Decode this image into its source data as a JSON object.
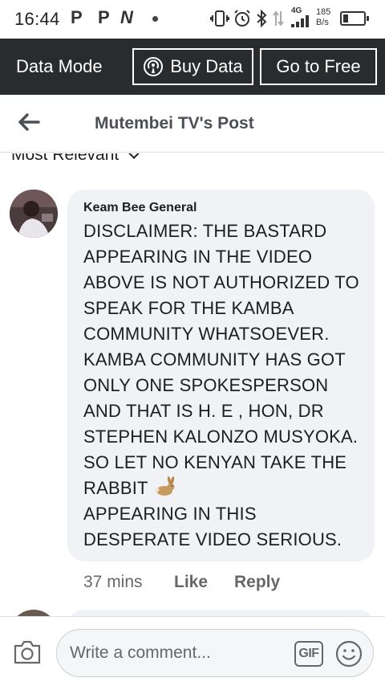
{
  "status_bar": {
    "time": "16:44",
    "notifications": [
      "P",
      "P",
      "N"
    ],
    "network": "4G",
    "speed_value": "185",
    "speed_unit": "B/s"
  },
  "data_bar": {
    "mode_label": "Data Mode",
    "buy_data_label": "Buy Data",
    "go_free_label": "Go to Free"
  },
  "header": {
    "title": "Mutembei TV's Post"
  },
  "sort": {
    "label": "Most Relevant"
  },
  "comment": {
    "author": "Keam Bee General",
    "text_before_emoji": "DISCLAIMER: THE BASTARD APPEARING IN THE VIDEO ABOVE IS NOT AUTHORIZED TO SPEAK FOR THE KAMBA COMMUNITY WHATSOEVER. KAMBA COMMUNITY HAS GOT ONLY ONE SPOKESPERSON AND THAT IS H. E , HON, DR STEPHEN KALONZO MUSYOKA. SO LET NO KENYAN TAKE THE RABBIT",
    "emoji": "rabbit",
    "text_after_emoji": "APPEARING IN THIS DESPERATE VIDEO SERIOUS.",
    "time": "37 mins",
    "like_label": "Like",
    "reply_label": "Reply"
  },
  "composer": {
    "placeholder": "Write a comment...",
    "gif_label": "GIF",
    "camera_icon": "camera-icon",
    "emoji_icon": "smiley-icon"
  },
  "colors": {
    "data_bar_bg": "#2a2b2d",
    "bubble_bg": "#f0f2f5",
    "muted_text": "#65676b"
  }
}
